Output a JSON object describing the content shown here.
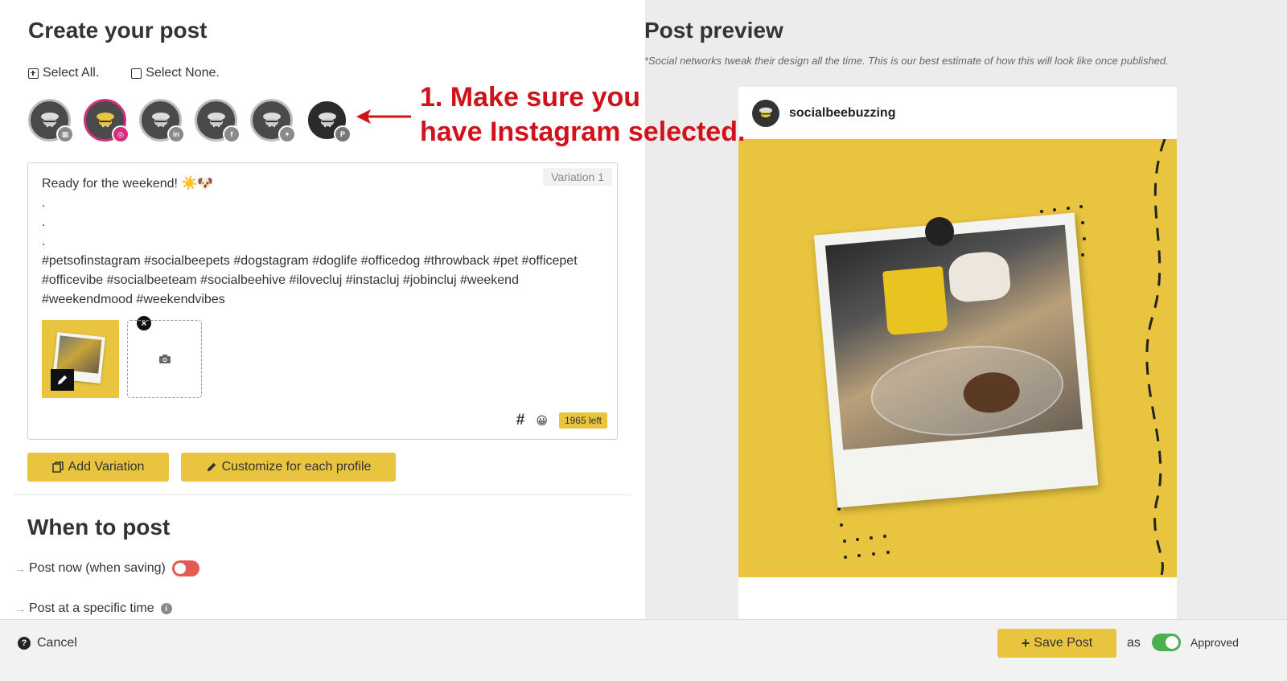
{
  "left": {
    "title": "Create your post",
    "select_all": "Select All.",
    "select_none": "Select None.",
    "profiles": [
      {
        "network": "google-business",
        "badge": "▦",
        "selected": false
      },
      {
        "network": "instagram",
        "badge": "◎",
        "selected": true
      },
      {
        "network": "linkedin",
        "badge": "in",
        "selected": false
      },
      {
        "network": "facebook",
        "badge": "f",
        "selected": false
      },
      {
        "network": "twitter",
        "badge": "✦",
        "selected": false
      },
      {
        "network": "pinterest",
        "badge": "P",
        "selected": false
      }
    ],
    "annotation": "1. Make sure you\nhave Instagram selected.",
    "editor": {
      "variation_label": "Variation 1",
      "text": "Ready for the weekend! ☀️🐶\n.\n.\n.\n#petsofinstagram #socialbeepets #dogstagram #doglife #officedog #throwback #pet #officepet #officevibe #socialbeeteam #socialbeehive #ilovecluj #instacluj #jobincluj #weekend #weekendmood #weekendvibes",
      "hashtag_icon": "#",
      "emoji_icon": "😀",
      "chars_left": "1965 left"
    },
    "buttons": {
      "add_variation": "Add Variation",
      "customize": "Customize for each profile"
    },
    "when_title": "When to post",
    "post_now": "Post now (when saving)",
    "post_specific": "Post at a specific time"
  },
  "preview": {
    "title": "Post preview",
    "note": "*Social networks tweak their design all the time. This is our best estimate of how this will look like once published.",
    "account": "socialbeebuzzing"
  },
  "footer": {
    "cancel": "Cancel",
    "save": "Save Post",
    "as": "as",
    "status": "Approved"
  },
  "colors": {
    "accent_yellow": "#e9c53f",
    "instagram": "#d42f7f",
    "annotation_red": "#d0121b",
    "toggle_on": "#4caf50",
    "toggle_off": "#e35a52"
  }
}
